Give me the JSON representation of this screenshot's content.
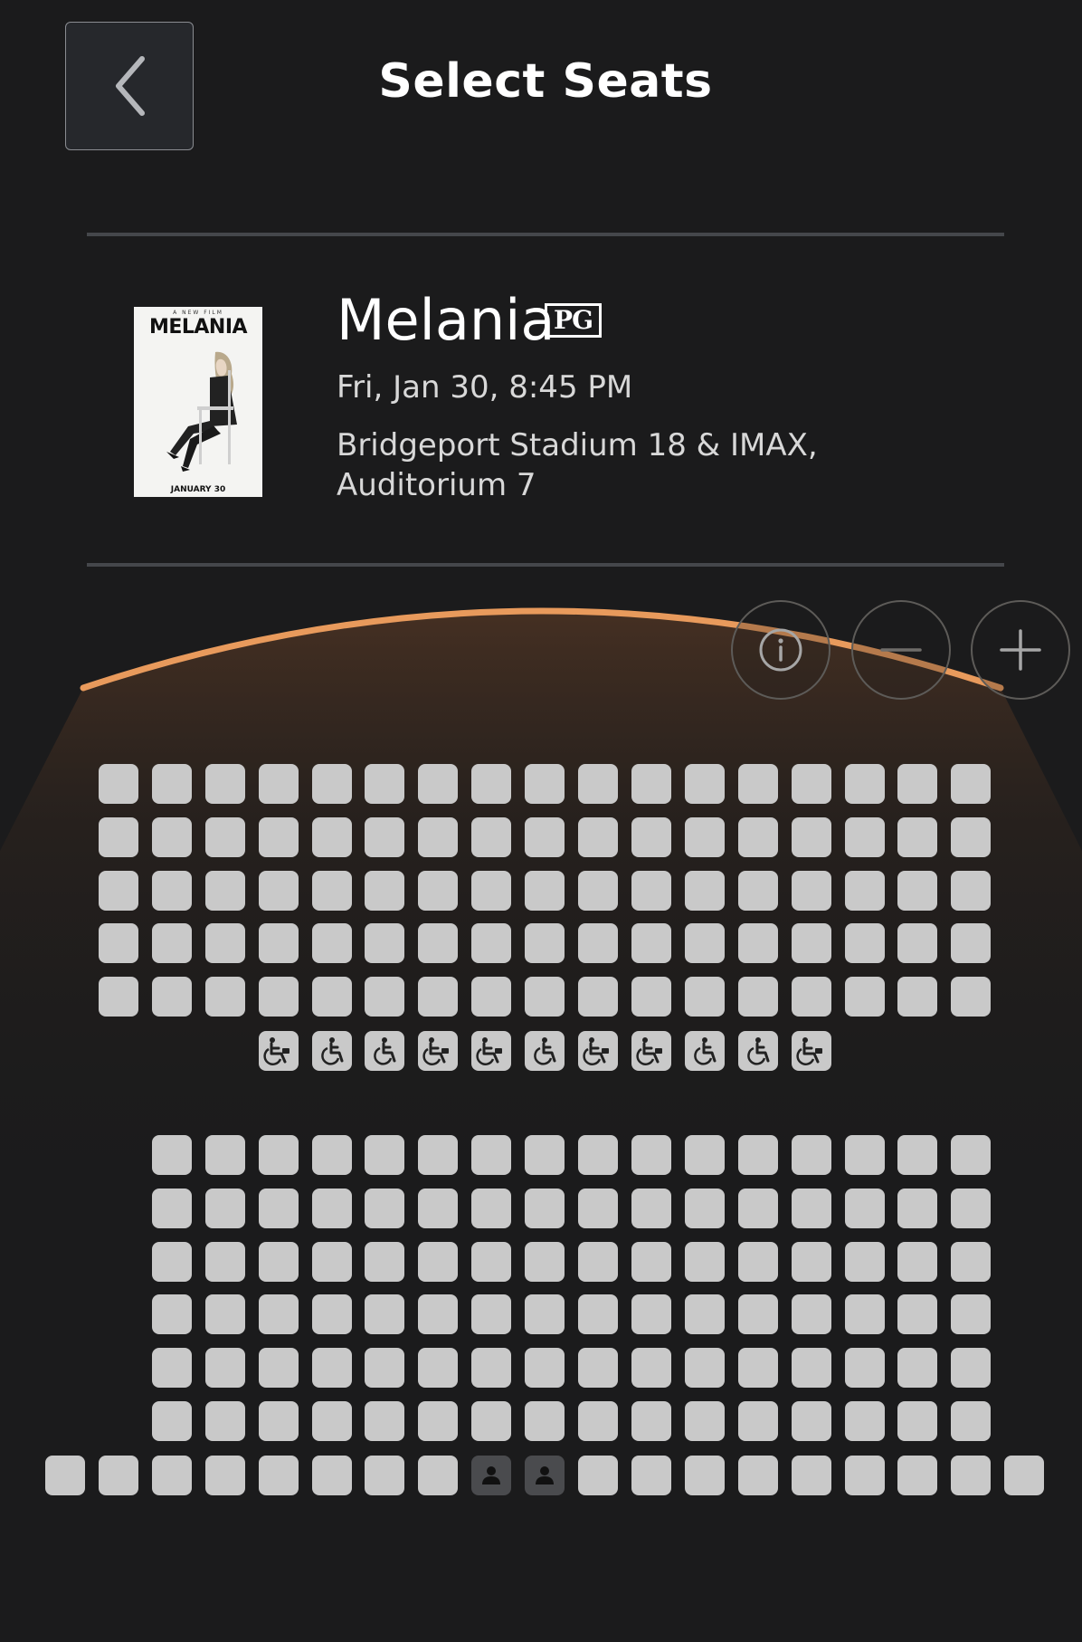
{
  "header": {
    "title": "Select Seats",
    "back_icon": "chevron-left-icon"
  },
  "movie": {
    "title": "Melania",
    "rating": "PG",
    "showtime": "Fri, Jan 30, 8:45 PM",
    "venue_line1": "Bridgeport Stadium 18 & IMAX,",
    "venue_line2": "Auditorium 7",
    "poster": {
      "tagline": "A NEW FILM",
      "title": "MELANIA",
      "date": "JANUARY 30"
    }
  },
  "controls": {
    "info_icon": "info-icon",
    "zoom_out_icon": "minus-icon",
    "zoom_in_icon": "plus-icon"
  },
  "colors": {
    "background": "#1b1b1c",
    "screen_arc": "#e89a5c",
    "seat_available": "#c9c9c9",
    "seat_occupied": "#4a4b4e"
  },
  "seating": {
    "front_section": {
      "standard_rows": 5,
      "seats_per_row": 17,
      "wheelchair_row": {
        "count": 11,
        "icon": "wheelchair-icon",
        "variants": [
          "power",
          "manual",
          "manual",
          "power",
          "power",
          "manual",
          "power",
          "power",
          "manual",
          "manual",
          "power"
        ]
      }
    },
    "rear_section": {
      "standard_rows": 6,
      "seats_per_row": 16,
      "last_row": {
        "seats": 19,
        "occupied_positions": [
          9,
          10
        ],
        "occupied_icon": "person-icon"
      }
    }
  }
}
